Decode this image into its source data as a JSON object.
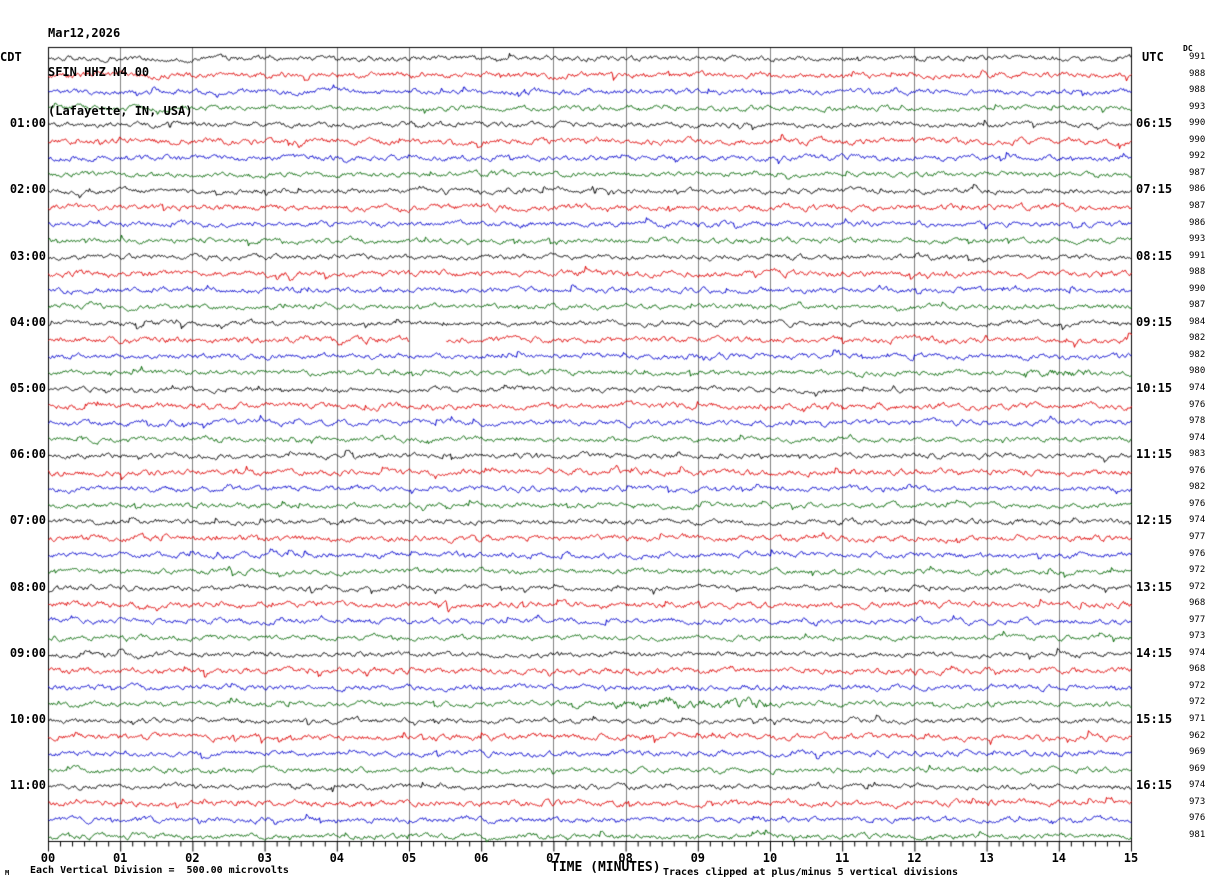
{
  "title": {
    "date": "Mar12,2026",
    "station": "SFIN HHZ N4 00",
    "location": "(Lafayette, IN, USA)"
  },
  "axes": {
    "left_header": "CDT",
    "right_header": "UTC",
    "dc_header": "DC"
  },
  "footer": {
    "scale_text": "Each Vertical Division =  500.00 microvolts",
    "time_label": "TIME (MINUTES)",
    "clip_text": "Traces clipped at plus/minus 5 vertical divisions",
    "corner_mark": "M"
  },
  "chart_data": {
    "type": "line",
    "subtype": "helicorder-seismogram",
    "title": "SFIN HHZ N4 00 Mar12,2026 (Lafayette, IN, USA)",
    "xlabel": "TIME (MINUTES)",
    "x_range_minutes": [
      0,
      15
    ],
    "x_tick_labels": [
      "00",
      "01",
      "02",
      "03",
      "04",
      "05",
      "06",
      "07",
      "08",
      "09",
      "10",
      "11",
      "12",
      "13",
      "14",
      "15"
    ],
    "minor_ticks_per_minute": 6,
    "grid": true,
    "grid_color": "#808080",
    "border_color": "#000000",
    "trace_colors": [
      "#000000",
      "#dd0000",
      "#0000cc",
      "#006600"
    ],
    "minutes_per_row": 15,
    "rows": [
      {
        "cdt": "",
        "utc": "",
        "dc": 991
      },
      {
        "cdt": "",
        "utc": "",
        "dc": 988
      },
      {
        "cdt": "",
        "utc": "",
        "dc": 988
      },
      {
        "cdt": "",
        "utc": "",
        "dc": 993
      },
      {
        "cdt": "01:00",
        "utc": "06:15",
        "dc": 990
      },
      {
        "cdt": "",
        "utc": "",
        "dc": 990
      },
      {
        "cdt": "",
        "utc": "",
        "dc": 992
      },
      {
        "cdt": "",
        "utc": "",
        "dc": 987
      },
      {
        "cdt": "02:00",
        "utc": "07:15",
        "dc": 986
      },
      {
        "cdt": "",
        "utc": "",
        "dc": 987
      },
      {
        "cdt": "",
        "utc": "",
        "dc": 986
      },
      {
        "cdt": "",
        "utc": "",
        "dc": 993
      },
      {
        "cdt": "03:00",
        "utc": "08:15",
        "dc": 991
      },
      {
        "cdt": "",
        "utc": "",
        "dc": 988
      },
      {
        "cdt": "",
        "utc": "",
        "dc": 990
      },
      {
        "cdt": "",
        "utc": "",
        "dc": 987
      },
      {
        "cdt": "04:00",
        "utc": "09:15",
        "dc": 984
      },
      {
        "cdt": "",
        "utc": "",
        "dc": 982
      },
      {
        "cdt": "",
        "utc": "",
        "dc": 982
      },
      {
        "cdt": "",
        "utc": "",
        "dc": 980
      },
      {
        "cdt": "05:00",
        "utc": "10:15",
        "dc": 974
      },
      {
        "cdt": "",
        "utc": "",
        "dc": 976
      },
      {
        "cdt": "",
        "utc": "",
        "dc": 978
      },
      {
        "cdt": "",
        "utc": "",
        "dc": 974
      },
      {
        "cdt": "06:00",
        "utc": "11:15",
        "dc": 983
      },
      {
        "cdt": "",
        "utc": "",
        "dc": 976
      },
      {
        "cdt": "",
        "utc": "",
        "dc": 982
      },
      {
        "cdt": "",
        "utc": "",
        "dc": 976
      },
      {
        "cdt": "07:00",
        "utc": "12:15",
        "dc": 974
      },
      {
        "cdt": "",
        "utc": "",
        "dc": 977
      },
      {
        "cdt": "",
        "utc": "",
        "dc": 976
      },
      {
        "cdt": "",
        "utc": "",
        "dc": 972
      },
      {
        "cdt": "08:00",
        "utc": "13:15",
        "dc": 972
      },
      {
        "cdt": "",
        "utc": "",
        "dc": 968
      },
      {
        "cdt": "",
        "utc": "",
        "dc": 977
      },
      {
        "cdt": "",
        "utc": "",
        "dc": 973
      },
      {
        "cdt": "09:00",
        "utc": "14:15",
        "dc": 974
      },
      {
        "cdt": "",
        "utc": "",
        "dc": 968
      },
      {
        "cdt": "",
        "utc": "",
        "dc": 972
      },
      {
        "cdt": "",
        "utc": "",
        "dc": 972
      },
      {
        "cdt": "10:00",
        "utc": "15:15",
        "dc": 971
      },
      {
        "cdt": "",
        "utc": "",
        "dc": 962
      },
      {
        "cdt": "",
        "utc": "",
        "dc": 969
      },
      {
        "cdt": "",
        "utc": "",
        "dc": 969
      },
      {
        "cdt": "11:00",
        "utc": "16:15",
        "dc": 974
      },
      {
        "cdt": "",
        "utc": "",
        "dc": 973
      },
      {
        "cdt": "",
        "utc": "",
        "dc": 976
      },
      {
        "cdt": "",
        "utc": "",
        "dc": 981
      }
    ],
    "data_gaps": [
      {
        "row": 17,
        "from_minute": 5.0,
        "to_minute": 5.5
      }
    ],
    "amplitude_bursts": [
      {
        "row": 19,
        "from_minute": 13.5,
        "to_minute": 14.4,
        "amp_factor": 1.7
      },
      {
        "row": 39,
        "from_minute": 7.8,
        "to_minute": 10.0,
        "amp_factor": 1.8
      }
    ],
    "clip_divisions": 5,
    "microvolts_per_division": 500.0
  }
}
